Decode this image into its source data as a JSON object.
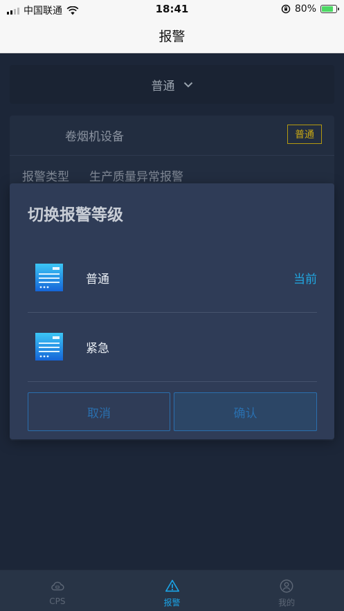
{
  "status_bar": {
    "carrier": "中国联通",
    "time": "18:41",
    "battery": "80%",
    "battery_level": 0.8
  },
  "nav": {
    "title": "报警"
  },
  "level_selector": {
    "value": "普通"
  },
  "alarm_card": {
    "device": "卷烟机设备",
    "badge": "普通",
    "type_label": "报警类型",
    "type_value": "生产质量异常报警"
  },
  "modal": {
    "title": "切换报警等级",
    "options": [
      {
        "label": "普通",
        "current": "当前"
      },
      {
        "label": "紧急"
      }
    ],
    "cancel": "取消",
    "confirm": "确认"
  },
  "tabs": [
    {
      "label": "CPS",
      "icon": "cloud-icon",
      "active": false
    },
    {
      "label": "报警",
      "icon": "warning-icon",
      "active": true
    },
    {
      "label": "我的",
      "icon": "user-icon",
      "active": false
    }
  ],
  "colors": {
    "accent": "#1aa3e6",
    "badge": "#c7a715",
    "modal_bg": "#2f3c57"
  }
}
